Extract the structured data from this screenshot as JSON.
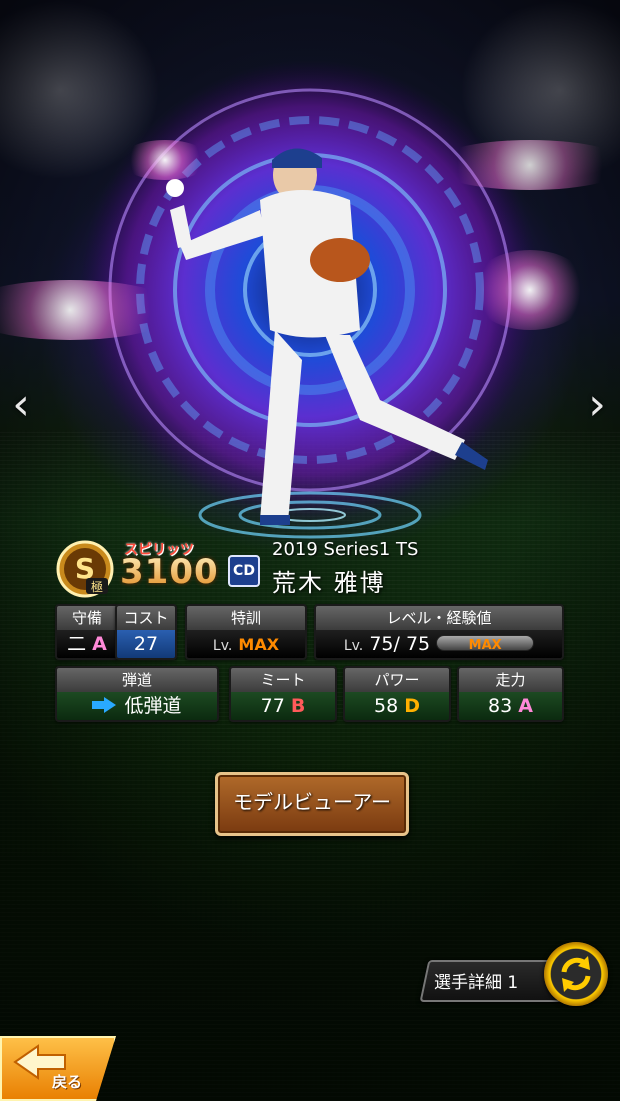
{
  "navigation": {
    "prev_icon": "chevron-left-icon",
    "next_icon": "chevron-right-icon",
    "prev_glyph": "‹",
    "next_glyph": "›"
  },
  "card": {
    "spirits_label": "スピリッツ",
    "spirits_value": "3100",
    "rank_badge": "S",
    "rank_sub": "極",
    "team_logo_text": "CD",
    "series": "2019 Series1 TS",
    "player_name": "荒木 雅博"
  },
  "stats": {
    "defense": {
      "header": "守備",
      "position": "二",
      "grade": "A"
    },
    "cost": {
      "header": "コスト",
      "value": "27"
    },
    "training": {
      "header": "特訓",
      "lv_prefix": "Lv.",
      "value": "MAX"
    },
    "level": {
      "header": "レベル・経験値",
      "lv_prefix": "Lv.",
      "current": "75",
      "separator": "/",
      "max": "75",
      "xp": "MAX"
    },
    "trajectory": {
      "header": "弾道",
      "value": "低弾道"
    },
    "contact": {
      "header": "ミート",
      "value": "77",
      "grade": "B"
    },
    "power": {
      "header": "パワー",
      "value": "58",
      "grade": "D"
    },
    "speed": {
      "header": "走力",
      "value": "83",
      "grade": "A"
    }
  },
  "buttons": {
    "model_viewer": "モデルビューアー",
    "player_detail": "選手詳細 1",
    "back": "戻る"
  },
  "colors": {
    "accent_orange": "#ff8a00",
    "grade_a": "#ff89d8",
    "grade_b": "#ff5a5a",
    "grade_d": "#ffb000",
    "trajectory_arrow": "#29a9ff"
  }
}
